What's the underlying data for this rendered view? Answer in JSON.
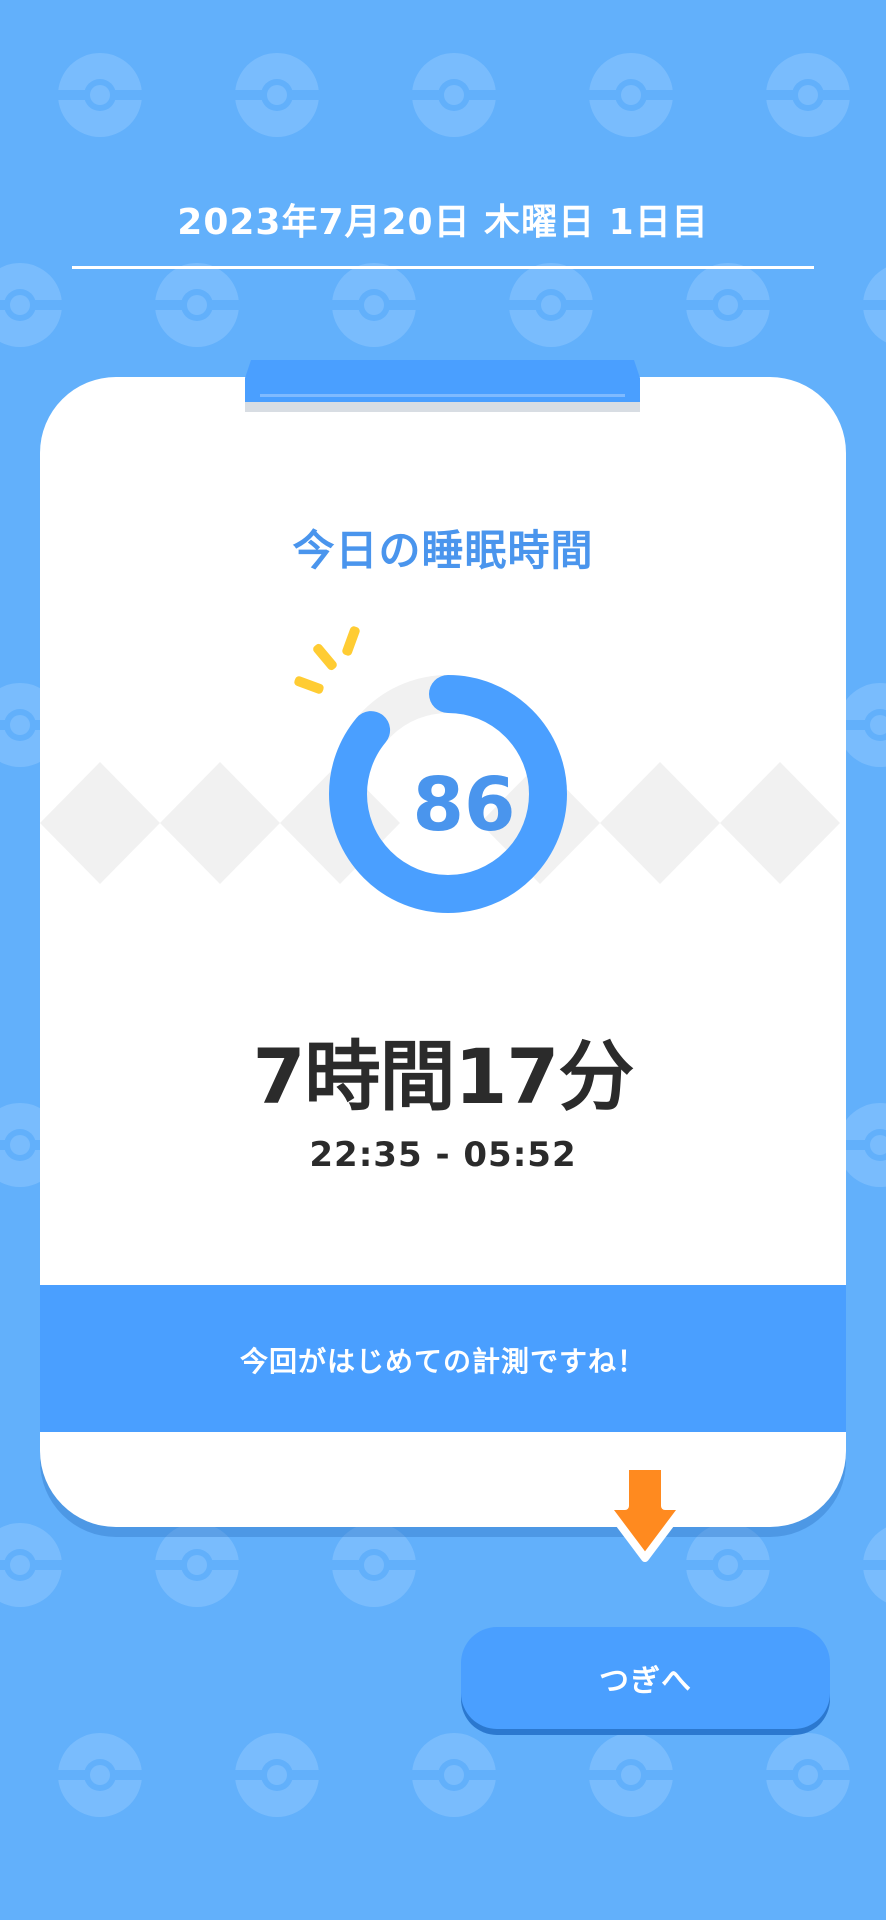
{
  "header": {
    "date_label": "2023年7月20日 木曜日 1日目"
  },
  "card": {
    "title": "今日の睡眠時間",
    "score": "86",
    "score_fraction": 0.86,
    "duration": "7時間17分",
    "time_range": "22:35 - 05:52",
    "message": "今回がはじめての計測ですね！"
  },
  "buttons": {
    "next_label": "つぎへ"
  },
  "colors": {
    "background": "#62b0fb",
    "accent": "#4a9fff",
    "accent_text": "#4a95ed",
    "arrow": "#ff8a1f",
    "sparkle": "#ffcc33"
  },
  "icons": {
    "background_pattern": "pokeball-icon",
    "hint_arrow": "arrow-down-icon",
    "sparkle": "sparkle-icon"
  }
}
